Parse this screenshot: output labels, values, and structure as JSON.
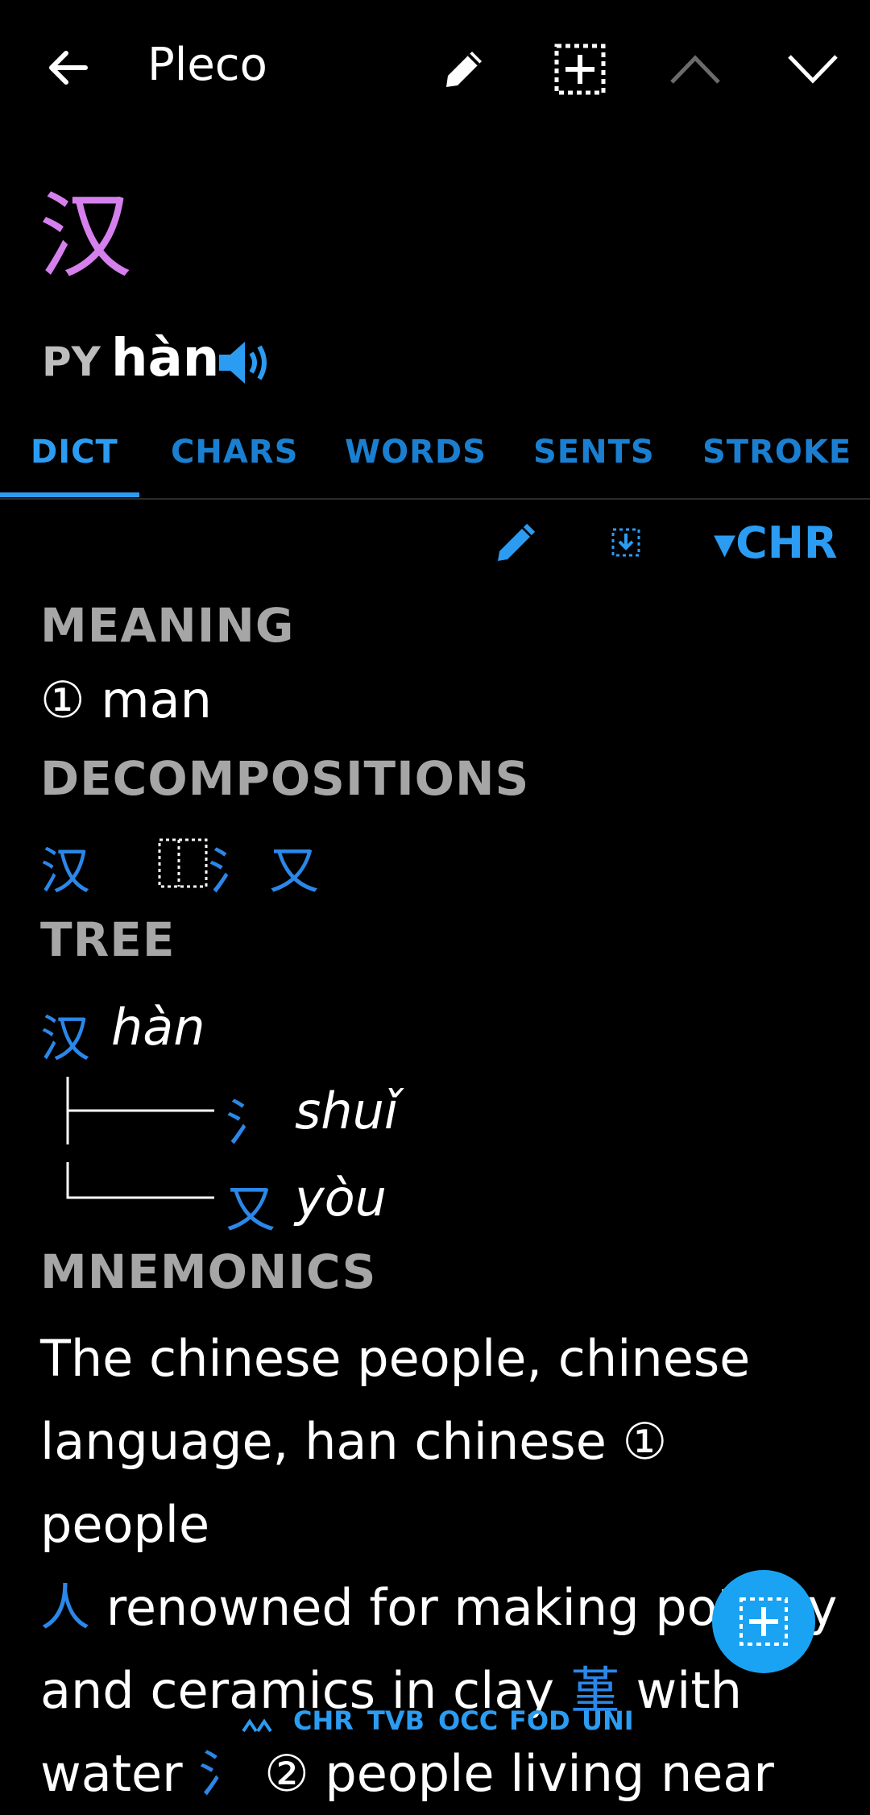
{
  "app_bar": {
    "title": "Pleco"
  },
  "entry": {
    "headword": "汉",
    "pinyin_label": "PY",
    "pinyin": "hàn"
  },
  "tabs": [
    {
      "label": "DICT"
    },
    {
      "label": "CHARS"
    },
    {
      "label": "WORDS"
    },
    {
      "label": "SENTS"
    },
    {
      "label": "STROKE"
    }
  ],
  "toolbar": {
    "dict_selector": "▾CHR"
  },
  "meaning": {
    "heading": "MEANING",
    "text": "① man"
  },
  "decompositions": {
    "heading": "DECOMPOSITIONS",
    "whole": "汉",
    "part1": "氵",
    "part2": "又"
  },
  "tree": {
    "heading": "TREE",
    "root_char": "汉",
    "root_pinyin": "hàn",
    "branch1_char": "氵",
    "branch1_pinyin": "shuǐ",
    "branch2_char": "又",
    "branch2_pinyin": "yòu"
  },
  "mnemonics": {
    "heading": "MNEMONICS",
    "line1": "The chinese people, chinese",
    "line2": "language, han chinese ① people",
    "line3_char": "人",
    "line3_text": " renowned for making pottery",
    "line4_text": "and ceramics in clay ",
    "line4_char": "堇",
    "line4_end": " with",
    "line5_text": "water ",
    "line5_char": "氵",
    "line5_end": " ② people living near"
  },
  "bottom_bar": [
    "CHR",
    "TVB",
    "OCC",
    "FOD",
    "UNI"
  ],
  "colors": {
    "accent": "#2b9cf2",
    "headword": "#d680ee",
    "section": "#a6a6a6",
    "fab": "#1aa3f2"
  }
}
